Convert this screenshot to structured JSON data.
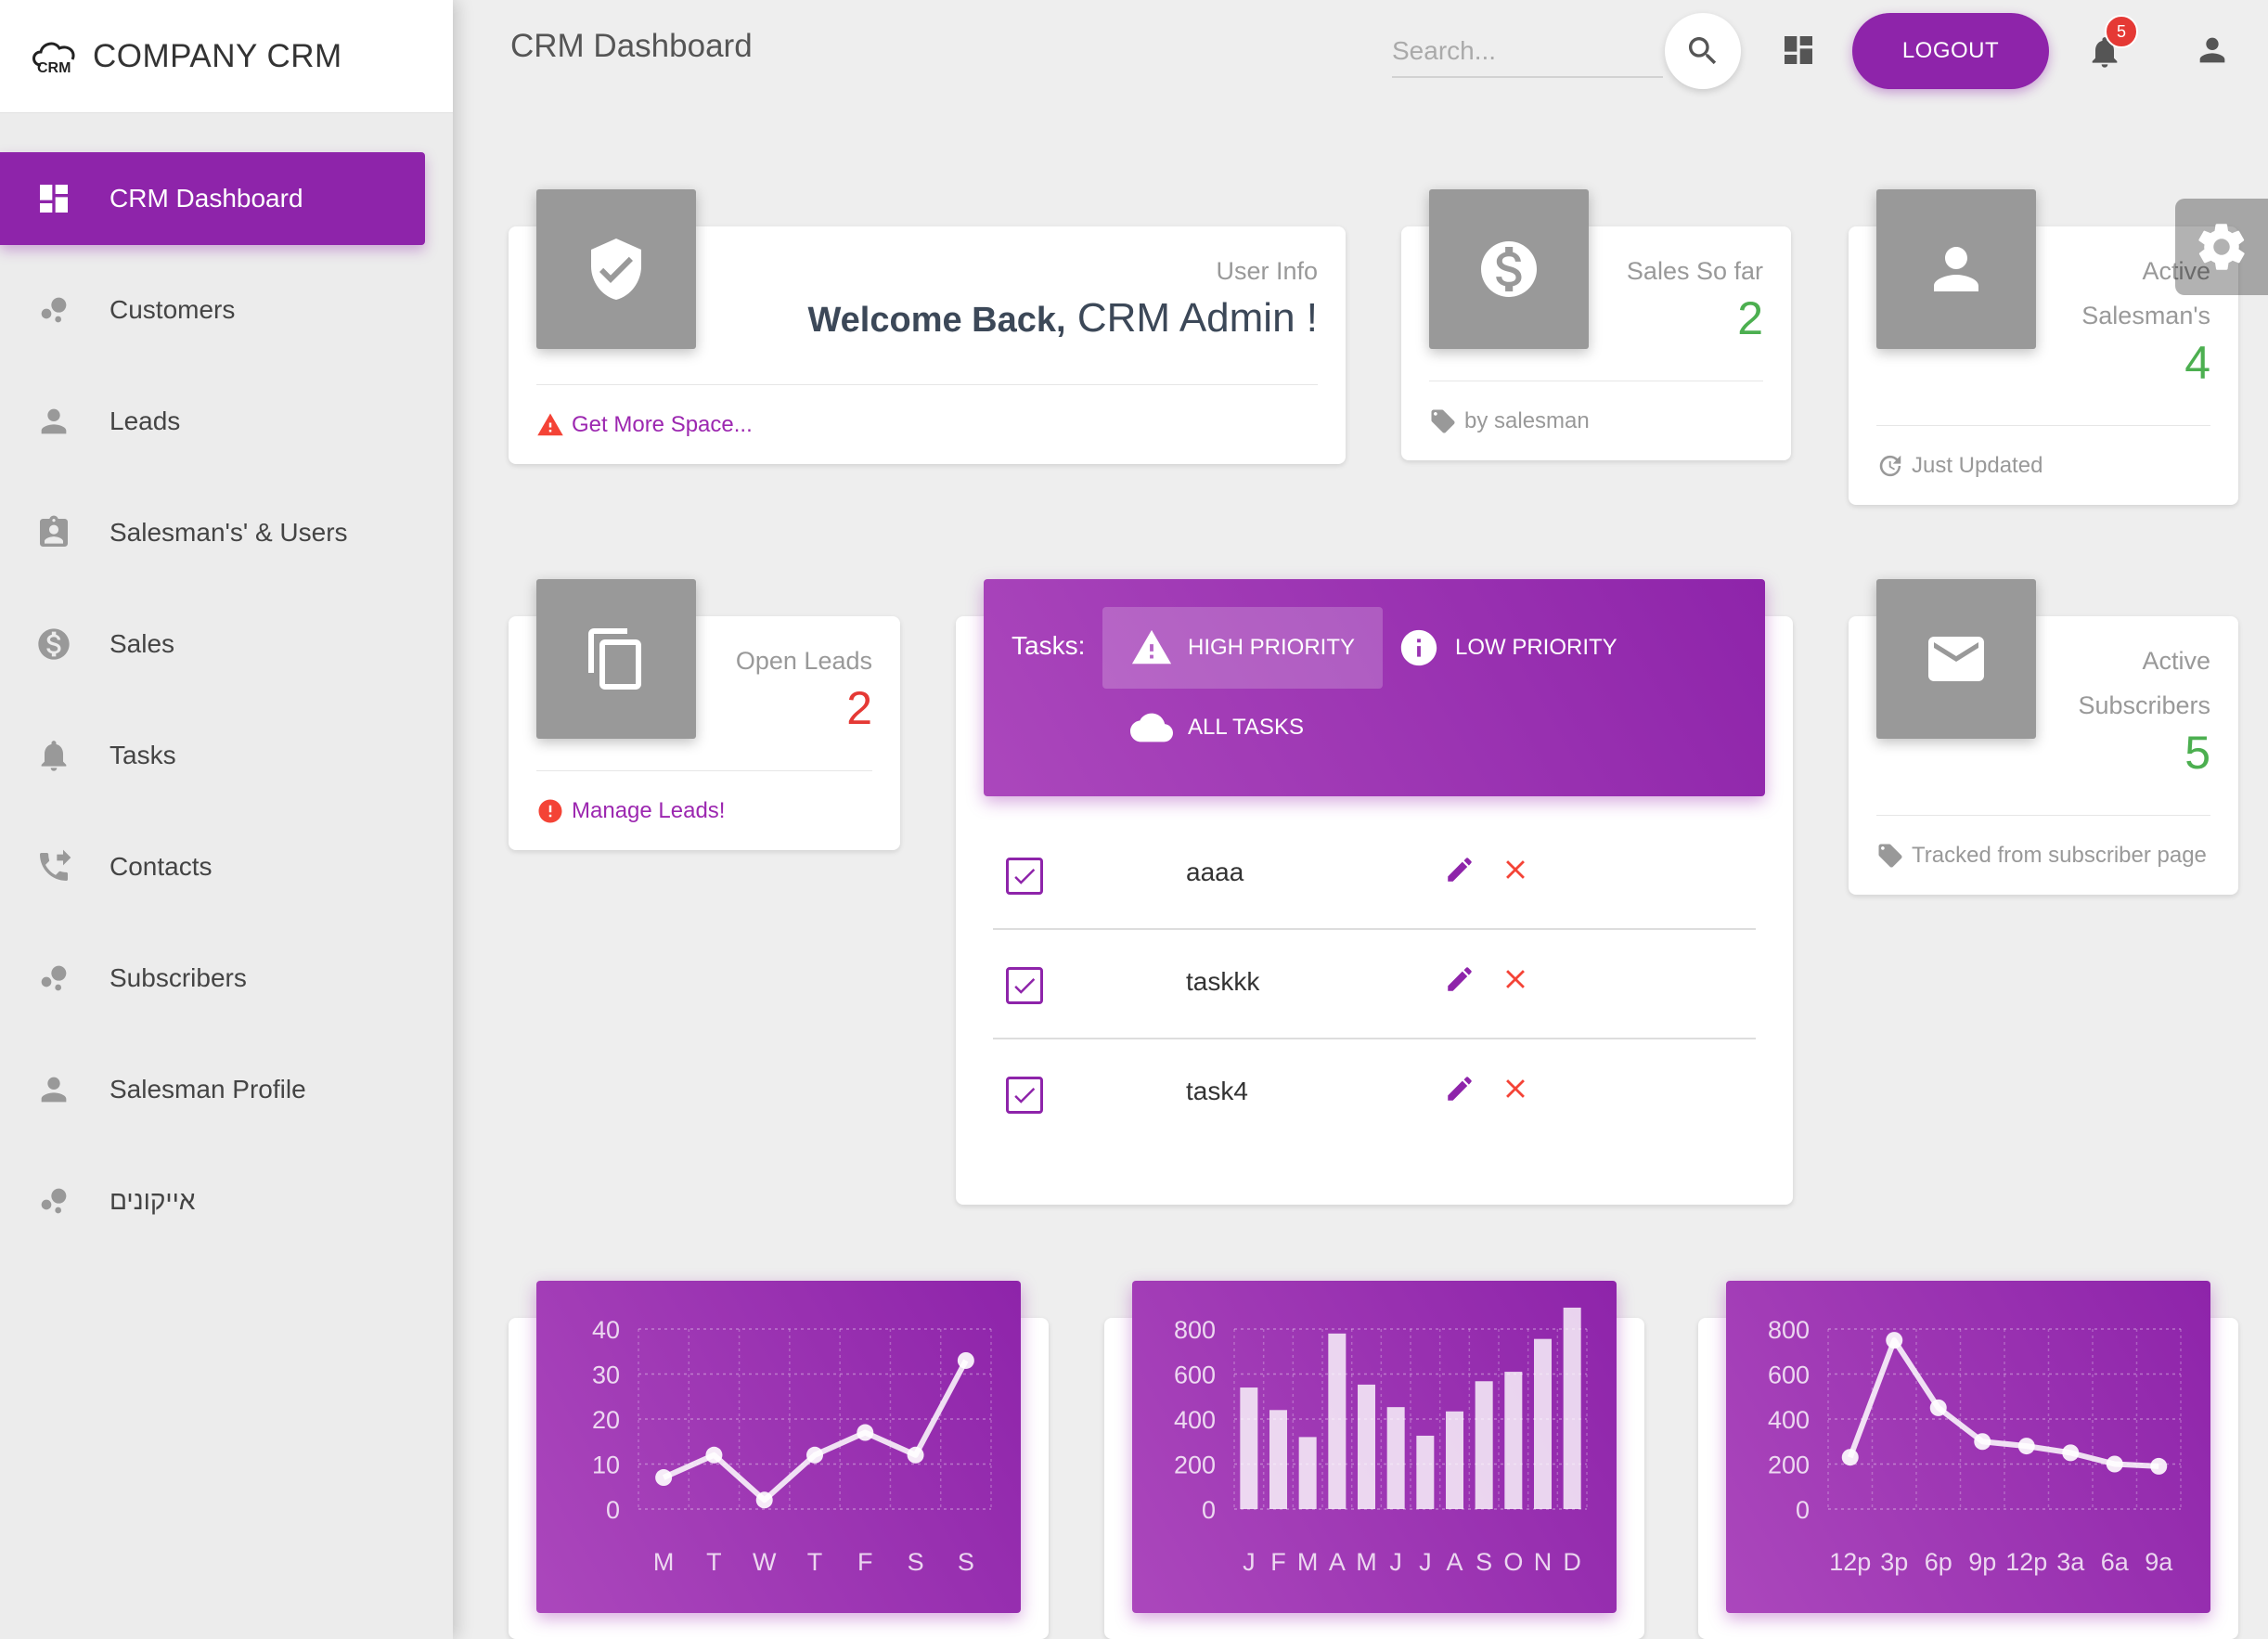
{
  "brand": {
    "name": "COMPANY CRM",
    "logo_text": "CRM"
  },
  "sidebar": {
    "items": [
      {
        "label": "CRM Dashboard",
        "icon": "dashboard-icon",
        "active": true
      },
      {
        "label": "Customers",
        "icon": "bubble-chart-icon"
      },
      {
        "label": "Leads",
        "icon": "person-icon"
      },
      {
        "label": "Salesman's' & Users",
        "icon": "assignment-ind-icon"
      },
      {
        "label": "Sales",
        "icon": "dollar-icon"
      },
      {
        "label": "Tasks",
        "icon": "bell-icon"
      },
      {
        "label": "Contacts",
        "icon": "phone-forwarded-icon"
      },
      {
        "label": "Subscribers",
        "icon": "bubble-chart-icon"
      },
      {
        "label": "Salesman Profile",
        "icon": "person-icon"
      },
      {
        "label": "אייקונים",
        "icon": "bubble-chart-icon"
      }
    ]
  },
  "header": {
    "title": "CRM Dashboard",
    "search_placeholder": "Search...",
    "logout_label": "LOGOUT",
    "notification_count": "5"
  },
  "cards": {
    "user_info": {
      "category": "User Info",
      "greeting": "Welcome Back,",
      "name": "CRM Admin !",
      "footer": "Get More Space..."
    },
    "sales": {
      "category": "Sales So far",
      "value": "2",
      "footer": "by salesman"
    },
    "salesmen": {
      "category_line1": "Active",
      "category_line2": "Salesman's",
      "value": "4",
      "footer": "Just Updated"
    },
    "open_leads": {
      "category": "Open Leads",
      "value": "2",
      "footer": "Manage Leads!"
    },
    "subscribers": {
      "category_line1": "Active",
      "category_line2": "Subscribers",
      "value": "5",
      "footer": "Tracked from subscriber page"
    }
  },
  "tasks": {
    "label": "Tasks:",
    "tabs": [
      {
        "label": "HIGH PRIORITY",
        "icon": "warning-icon",
        "active": true
      },
      {
        "label": "LOW PRIORITY",
        "icon": "info-icon"
      },
      {
        "label": "ALL TASKS",
        "icon": "cloud-icon"
      }
    ],
    "items": [
      {
        "text": "aaaa",
        "checked": true
      },
      {
        "text": "taskkk",
        "checked": true
      },
      {
        "text": "task4",
        "checked": true
      }
    ]
  },
  "colors": {
    "primary": "#8e24aa",
    "success": "#4caf50",
    "danger": "#f44336",
    "icon_bg": "#999999"
  },
  "chart_data": [
    {
      "type": "line",
      "categories": [
        "M",
        "T",
        "W",
        "T",
        "F",
        "S",
        "S"
      ],
      "values": [
        7,
        12,
        2,
        12,
        17,
        12,
        33
      ],
      "y_ticks": [
        "40",
        "30",
        "20",
        "10",
        "0"
      ],
      "ylim": [
        0,
        40
      ],
      "grid": true
    },
    {
      "type": "bar",
      "categories": [
        "J",
        "F",
        "M",
        "A",
        "M",
        "J",
        "J",
        "A",
        "S",
        "O",
        "N",
        "D"
      ],
      "values": [
        540,
        440,
        320,
        780,
        553,
        453,
        326,
        434,
        568,
        610,
        756,
        895
      ],
      "y_ticks": [
        "800",
        "600",
        "400",
        "200",
        "0"
      ],
      "ylim": [
        0,
        800
      ],
      "grid": true
    },
    {
      "type": "line",
      "categories": [
        "12p",
        "3p",
        "6p",
        "9p",
        "12p",
        "3a",
        "6a",
        "9a"
      ],
      "values": [
        230,
        750,
        450,
        300,
        280,
        250,
        200,
        190
      ],
      "y_ticks": [
        "800",
        "600",
        "400",
        "200",
        "0"
      ],
      "ylim": [
        0,
        800
      ],
      "grid": true
    }
  ]
}
